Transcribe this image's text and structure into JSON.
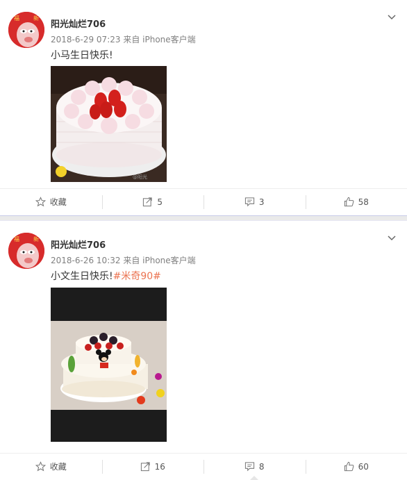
{
  "posts": [
    {
      "user": "阳光灿烂706",
      "time": "2018-6-29 07:23",
      "source": "来自 iPhone客户端",
      "text": "小马生日快乐!",
      "topic": "",
      "image_watermark": "@阳光",
      "actions": {
        "favorite": "收藏",
        "repost": "5",
        "comment": "3",
        "like": "58"
      }
    },
    {
      "user": "阳光灿烂706",
      "time": "2018-6-26 10:32",
      "source": "来自 iPhone客户端",
      "text": "小文生日快乐!",
      "topic": "#米奇90#",
      "actions": {
        "favorite": "收藏",
        "repost": "16",
        "comment": "8",
        "like": "60"
      }
    }
  ],
  "colors": {
    "topic": "#eb7350",
    "separator": "#c8cbe8",
    "avatar": "#d72b2b"
  },
  "icons": [
    "star-icon",
    "repost-icon",
    "comment-icon",
    "thumbs-up-icon",
    "chevron-down-icon"
  ]
}
